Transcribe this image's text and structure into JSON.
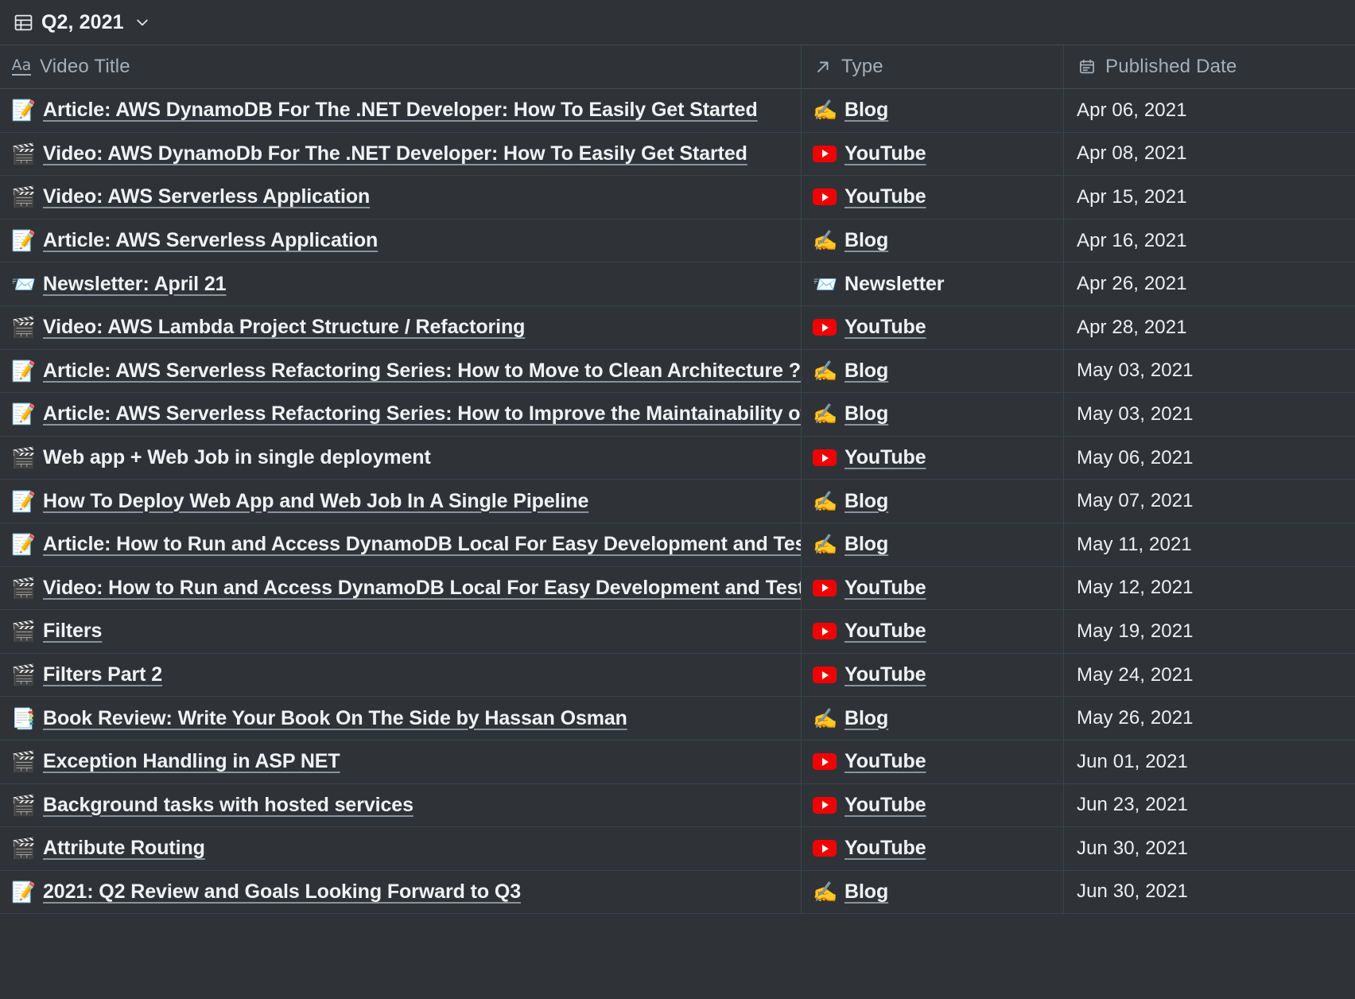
{
  "titlebar": {
    "icon": "table-icon",
    "title": "Q2, 2021",
    "chevron": "chevron-down-icon"
  },
  "table": {
    "columns": [
      {
        "key": "title",
        "label": "Video Title",
        "icon": "text-aa-icon"
      },
      {
        "key": "type",
        "label": "Type",
        "icon": "arrow-up-right-icon"
      },
      {
        "key": "date",
        "label": "Published Date",
        "icon": "calendar-icon"
      }
    ],
    "rows": [
      {
        "icon": "notepad-pencil-icon",
        "title": "Article: AWS DynamoDB For The .NET Developer: How To Easily Get Started",
        "link": true,
        "type": "Blog",
        "type_icon": "writing-hand-icon",
        "type_link": true,
        "date": "Apr 06, 2021"
      },
      {
        "icon": "clapper-board-icon",
        "title": "Video: AWS DynamoDb For The .NET Developer: How To Easily Get Started",
        "link": true,
        "type": "YouTube",
        "type_icon": "youtube-icon",
        "type_link": true,
        "date": "Apr 08, 2021"
      },
      {
        "icon": "clapper-board-icon",
        "title": "Video: AWS Serverless Application",
        "link": true,
        "type": "YouTube",
        "type_icon": "youtube-icon",
        "type_link": true,
        "date": "Apr 15, 2021"
      },
      {
        "icon": "notepad-pencil-icon",
        "title": "Article: AWS Serverless Application",
        "link": true,
        "type": "Blog",
        "type_icon": "writing-hand-icon",
        "type_link": true,
        "date": "Apr 16, 2021"
      },
      {
        "icon": "newsletter-envelope-icon",
        "title": "Newsletter: April 21",
        "link": true,
        "type": "Newsletter",
        "type_icon": "newsletter-envelope-icon",
        "type_link": false,
        "date": "Apr 26, 2021"
      },
      {
        "icon": "clapper-board-icon",
        "title": "Video: AWS Lambda Project Structure / Refactoring",
        "link": true,
        "type": "YouTube",
        "type_icon": "youtube-icon",
        "type_link": true,
        "date": "Apr 28, 2021"
      },
      {
        "icon": "notepad-pencil-icon",
        "title": "Article: AWS Serverless Refactoring Series: How to Move to Clean Architecture ?",
        "link": true,
        "type": "Blog",
        "type_icon": "writing-hand-icon",
        "type_link": true,
        "date": "May 03, 2021"
      },
      {
        "icon": "notepad-pencil-icon",
        "title": "Article: AWS Serverless Refactoring Series: How to Improve the Maintainability of Project",
        "link": true,
        "type": "Blog",
        "type_icon": "writing-hand-icon",
        "type_link": true,
        "date": "May 03, 2021"
      },
      {
        "icon": "clapper-board-icon",
        "title": "Web app + Web Job in single deployment",
        "link": false,
        "type": "YouTube",
        "type_icon": "youtube-icon",
        "type_link": true,
        "date": "May 06, 2021"
      },
      {
        "icon": "notepad-pencil-icon",
        "title": "How To Deploy Web App and Web Job In A Single Pipeline",
        "link": true,
        "type": "Blog",
        "type_icon": "writing-hand-icon",
        "type_link": true,
        "date": "May 07, 2021"
      },
      {
        "icon": "notepad-pencil-icon",
        "title": "Article: How to Run and Access DynamoDB Local For Easy Development and Testing",
        "link": true,
        "type": "Blog",
        "type_icon": "writing-hand-icon",
        "type_link": true,
        "date": "May 11, 2021"
      },
      {
        "icon": "clapper-board-icon",
        "title": "Video: How to Run and Access DynamoDB Local For Easy Development and Testing",
        "link": true,
        "type": "YouTube",
        "type_icon": "youtube-icon",
        "type_link": true,
        "date": "May 12, 2021"
      },
      {
        "icon": "clapper-board-icon",
        "title": "Filters",
        "link": true,
        "type": "YouTube",
        "type_icon": "youtube-icon",
        "type_link": true,
        "date": "May 19, 2021"
      },
      {
        "icon": "clapper-board-icon",
        "title": "Filters Part 2",
        "link": true,
        "type": "YouTube",
        "type_icon": "youtube-icon",
        "type_link": true,
        "date": "May 24, 2021"
      },
      {
        "icon": "book-review-thumbsup-icon",
        "title": "Book Review: Write Your Book On The Side by Hassan Osman",
        "link": true,
        "type": "Blog",
        "type_icon": "writing-hand-icon",
        "type_link": true,
        "date": "May 26, 2021"
      },
      {
        "icon": "clapper-board-icon",
        "title": "Exception Handling in ASP NET",
        "link": true,
        "type": "YouTube",
        "type_icon": "youtube-icon",
        "type_link": true,
        "date": "Jun 01, 2021"
      },
      {
        "icon": "clapper-board-icon",
        "title": "Background tasks with hosted services",
        "link": true,
        "type": "YouTube",
        "type_icon": "youtube-icon",
        "type_link": true,
        "date": "Jun 23, 2021"
      },
      {
        "icon": "clapper-board-icon",
        "title": "Attribute Routing",
        "link": true,
        "type": "YouTube",
        "type_icon": "youtube-icon",
        "type_link": true,
        "date": "Jun 30, 2021"
      },
      {
        "icon": "notepad-pencil-icon",
        "title": "2021: Q2 Review and Goals Looking Forward to Q3",
        "link": true,
        "type": "Blog",
        "type_icon": "writing-hand-icon",
        "type_link": true,
        "date": "Jun 30, 2021"
      }
    ]
  },
  "glyphs": {
    "notepad-pencil-icon": "📝",
    "clapper-board-icon": "🎬",
    "newsletter-envelope-icon": "📨",
    "book-review-thumbsup-icon": "📑",
    "writing-hand-icon": "✍️"
  },
  "colors": {
    "background": "#2f3337",
    "row_border": "#3c4147",
    "header_text": "#a7aeb5",
    "body_text": "#f0f2f4",
    "youtube_red": "#f00204"
  }
}
